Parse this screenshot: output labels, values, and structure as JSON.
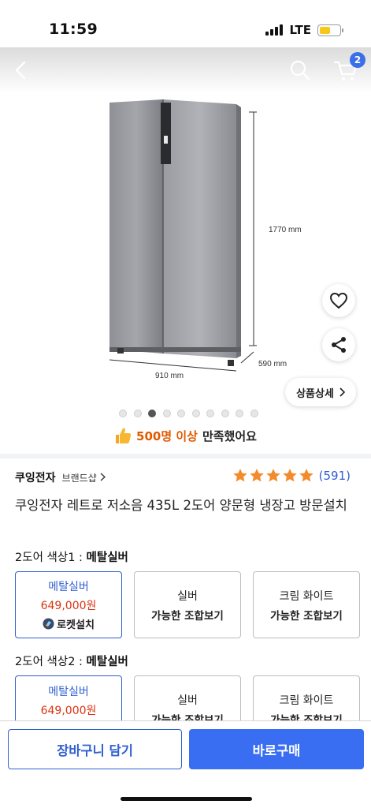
{
  "status_bar": {
    "time": "11:59",
    "network": "LTE",
    "battery_level": 0.55
  },
  "nav": {
    "cart_badge": "2",
    "icons": [
      "back-arrow-icon",
      "search-icon",
      "cart-icon"
    ]
  },
  "image": {
    "height_label": "1770 mm",
    "width_label": "910 mm",
    "depth_label": "590 mm",
    "total_images": 10,
    "active_image": 3
  },
  "actions": {
    "detail_label": "상품상세"
  },
  "satisfaction": {
    "count": "500명 이상",
    "rest": "만족했어요"
  },
  "product": {
    "brand": "쿠잉전자",
    "brand_shop": "브랜드샵",
    "rating_stars": 5,
    "review_count": "(591)",
    "title": "쿠잉전자 레트로 저소음 435L 2도어 양문형 냉장고 방문설치"
  },
  "options": [
    {
      "label_prefix": "2도어 색상1 : ",
      "label_value": "메탈실버",
      "cards": [
        {
          "name": "메탈실버",
          "price": "649,000원",
          "badge": "로켓설치",
          "selected": true
        },
        {
          "name": "실버",
          "sub": "가능한 조합보기"
        },
        {
          "name": "크림 화이트",
          "sub": "가능한 조합보기"
        }
      ]
    },
    {
      "label_prefix": "2도어 색상2 : ",
      "label_value": "메탈실버",
      "cards": [
        {
          "name": "메탈실버",
          "price": "649,000원",
          "selected": true
        },
        {
          "name": "실버",
          "sub": "가능한 조합보기"
        },
        {
          "name": "크림 화이트",
          "sub": "가능한 조합보기"
        }
      ]
    }
  ],
  "bottom": {
    "cart_label": "장바구니 담기",
    "buy_label": "바로구매"
  },
  "colors": {
    "accent": "#3a6ef2",
    "price": "#dd3311",
    "star": "#f28b2c",
    "highlight": "#e05a00"
  }
}
